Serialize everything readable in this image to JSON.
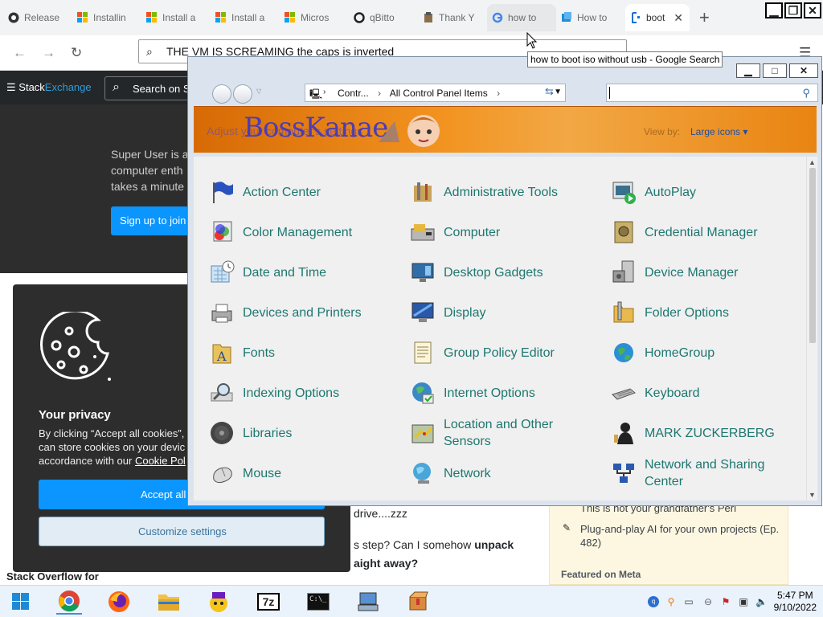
{
  "browser": {
    "tabs": [
      {
        "title": "Release",
        "favicon": "github-icon"
      },
      {
        "title": "Installin",
        "favicon": "microsoft-icon"
      },
      {
        "title": "Install a",
        "favicon": "microsoft-icon"
      },
      {
        "title": "Install a",
        "favicon": "microsoft-icon"
      },
      {
        "title": "Micros",
        "favicon": "microsoft-icon"
      },
      {
        "title": "qBitto",
        "favicon": "qbittorrent-icon"
      },
      {
        "title": "Thank Y",
        "favicon": "extension-icon"
      },
      {
        "title": "how to",
        "favicon": "google-icon"
      },
      {
        "title": "How to",
        "favicon": "superuser-icon"
      },
      {
        "title": "boot",
        "favicon": "stackexchange-icon"
      }
    ],
    "address": "THE VM IS SCREAMING the caps is inverted",
    "tooltip": "how to boot iso without usb - Google Search"
  },
  "site": {
    "logo_a": "Stack",
    "logo_b": "Exchange",
    "search_placeholder": "Search on S",
    "hero_text": "Super User is a computer enth takes a minute",
    "signup": "Sign up to join",
    "question_line1": "drive....zzz",
    "question_line2a": "s step? Can I somehow ",
    "question_bold1": "unpack",
    "question_line3": "aight away?",
    "sidebar_item1": "This is not your grandfather's Perl",
    "sidebar_item2": "Plug-and-play AI for your own projects (Ep. 482)",
    "featured_meta": "Featured on Meta",
    "so_label": "Stack Overflow for"
  },
  "cookie": {
    "title": "Your privacy",
    "text_pre": "By clicking “Accept all cookies”, y can store cookies on your devic accordance with our ",
    "link": "Cookie Pol",
    "accept": "Accept all",
    "customize": "Customize settings"
  },
  "control_panel": {
    "crumb1": "Contr...",
    "crumb2": "All Control Panel Items",
    "brand": "BossKanae",
    "adjust": "Adjust your computer's settings",
    "view_by_label": "View by:",
    "view_by_value": "Large icons ▾",
    "items": [
      {
        "label": "Action Center",
        "icon": "flag-icon"
      },
      {
        "label": "Administrative Tools",
        "icon": "admin-tools-icon"
      },
      {
        "label": "AutoPlay",
        "icon": "autoplay-icon"
      },
      {
        "label": "Color Management",
        "icon": "color-management-icon"
      },
      {
        "label": "Computer",
        "icon": "computer-icon"
      },
      {
        "label": "Credential Manager",
        "icon": "vault-icon"
      },
      {
        "label": "Date and Time",
        "icon": "calendar-clock-icon"
      },
      {
        "label": "Desktop Gadgets",
        "icon": "gadgets-icon"
      },
      {
        "label": "Device Manager",
        "icon": "device-manager-icon"
      },
      {
        "label": "Devices and Printers",
        "icon": "printer-icon"
      },
      {
        "label": "Display",
        "icon": "monitor-icon"
      },
      {
        "label": "Folder Options",
        "icon": "folder-options-icon"
      },
      {
        "label": "Fonts",
        "icon": "fonts-folder-icon"
      },
      {
        "label": "Group Policy Editor",
        "icon": "policy-document-icon"
      },
      {
        "label": "HomeGroup",
        "icon": "homegroup-globe-icon"
      },
      {
        "label": "Indexing Options",
        "icon": "magnifier-icon"
      },
      {
        "label": "Internet Options",
        "icon": "internet-globe-icon"
      },
      {
        "label": "Keyboard",
        "icon": "keyboard-icon"
      },
      {
        "label": "Libraries",
        "icon": "libraries-disc-icon"
      },
      {
        "label": "Location and Other Sensors",
        "icon": "sensors-icon"
      },
      {
        "label": "MARK ZUCKERBERG",
        "icon": "user-silhouette-icon"
      },
      {
        "label": "Mouse",
        "icon": "mouse-icon"
      },
      {
        "label": "Network",
        "icon": "network-globe-icon"
      },
      {
        "label": "Network and Sharing Center",
        "icon": "network-sharing-icon"
      }
    ]
  },
  "taskbar": {
    "apps": [
      "windows-start-icon",
      "chrome-icon",
      "firefox-icon",
      "file-explorer-icon",
      "yahoo-icon",
      "7zip-icon",
      "command-prompt-icon",
      "virtual-machine-icon",
      "package-icon"
    ],
    "seven_zip": "7z",
    "cmd_prompt": "C:\\_",
    "time": "5:47 PM",
    "date": "9/10/2022"
  },
  "colors": {
    "accent_blue": "#0a95ff",
    "cp_item_text": "#1e7770",
    "banner_orange": "#f29320"
  }
}
